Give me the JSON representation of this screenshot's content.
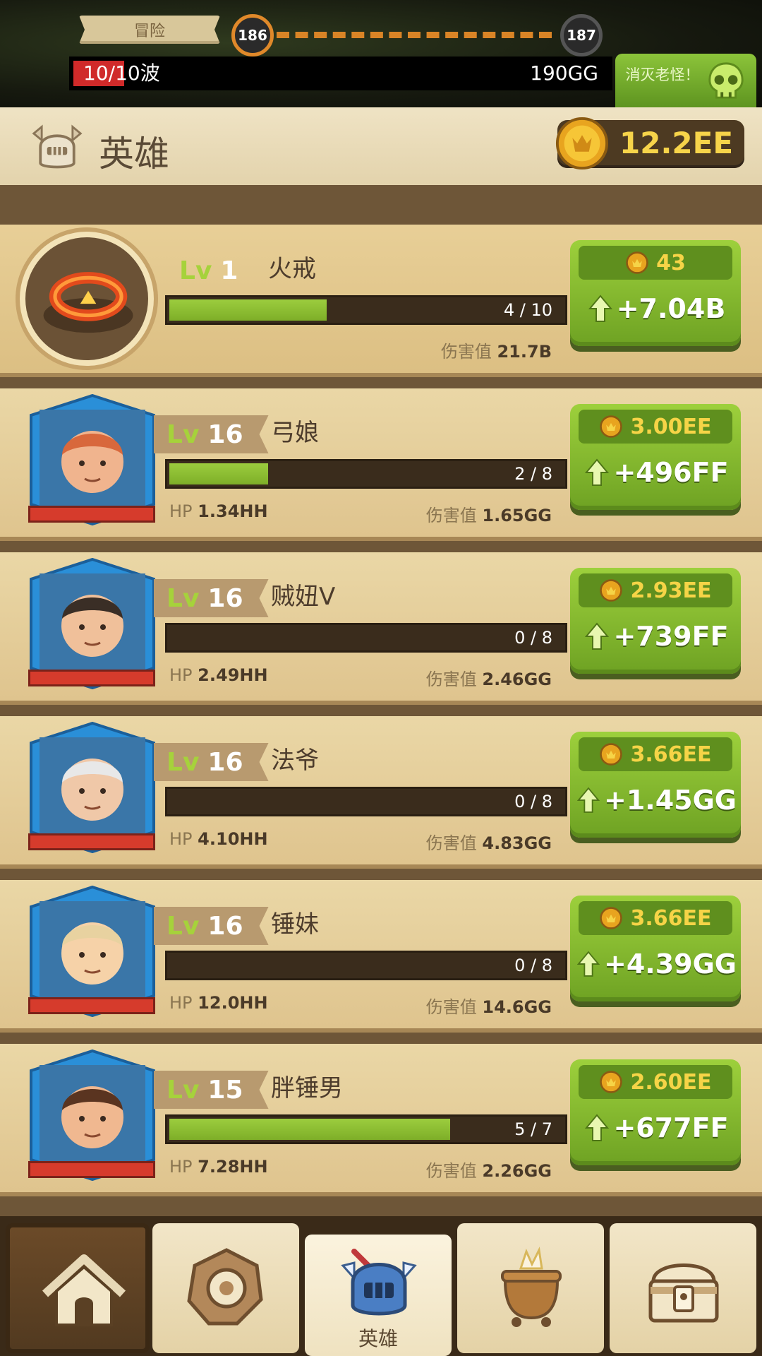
{
  "top": {
    "adventure_label": "冒险",
    "current_stage": "186",
    "next_stage": "187",
    "wave_text": "10/10波",
    "gold_total": "190GG",
    "boss_button_label": "消灭老怪！"
  },
  "header": {
    "title": "英雄",
    "coins": "12.2EE"
  },
  "heroes": [
    {
      "level_tag": "Lv",
      "level": "1",
      "name": "火戒",
      "progress_text": "4 / 10",
      "progress": 0.4,
      "hp_label": "",
      "hp": "",
      "dmg_label": "伤害值",
      "dmg": "21.7B",
      "cost": "43",
      "gain": "+7.04B"
    },
    {
      "level_tag": "Lv",
      "level": "16",
      "name": "弓娘",
      "progress_text": "2 / 8",
      "progress": 0.25,
      "hp_label": "HP",
      "hp": "1.34HH",
      "dmg_label": "伤害值",
      "dmg": "1.65GG",
      "cost": "3.00EE",
      "gain": "+496FF"
    },
    {
      "level_tag": "Lv",
      "level": "16",
      "name": "贼妞V",
      "progress_text": "0 / 8",
      "progress": 0,
      "hp_label": "HP",
      "hp": "2.49HH",
      "dmg_label": "伤害值",
      "dmg": "2.46GG",
      "cost": "2.93EE",
      "gain": "+739FF"
    },
    {
      "level_tag": "Lv",
      "level": "16",
      "name": "法爷",
      "progress_text": "0 / 8",
      "progress": 0,
      "hp_label": "HP",
      "hp": "4.10HH",
      "dmg_label": "伤害值",
      "dmg": "4.83GG",
      "cost": "3.66EE",
      "gain": "+1.45GG"
    },
    {
      "level_tag": "Lv",
      "level": "16",
      "name": "锤妹",
      "progress_text": "0 / 8",
      "progress": 0,
      "hp_label": "HP",
      "hp": "12.0HH",
      "dmg_label": "伤害值",
      "dmg": "14.6GG",
      "cost": "3.66EE",
      "gain": "+4.39GG"
    },
    {
      "level_tag": "Lv",
      "level": "15",
      "name": "胖锤男",
      "progress_text": "5 / 7",
      "progress": 0.714,
      "hp_label": "HP",
      "hp": "7.28HH",
      "dmg_label": "伤害值",
      "dmg": "2.26GG",
      "cost": "2.60EE",
      "gain": "+677FF"
    }
  ],
  "nav": {
    "active_label": "英雄"
  },
  "colors": {
    "accent_green": "#8cc43a",
    "gold": "#f7d44a",
    "hp_red": "#d63b2c",
    "frame_blue": "#2a8fd8"
  },
  "icons": [
    "helmet-icon",
    "coin-icon",
    "skull-icon",
    "ring-icon",
    "arrow-up-icon",
    "home-icon",
    "gear-icon",
    "knight-icon",
    "cauldron-icon",
    "chest-icon"
  ]
}
